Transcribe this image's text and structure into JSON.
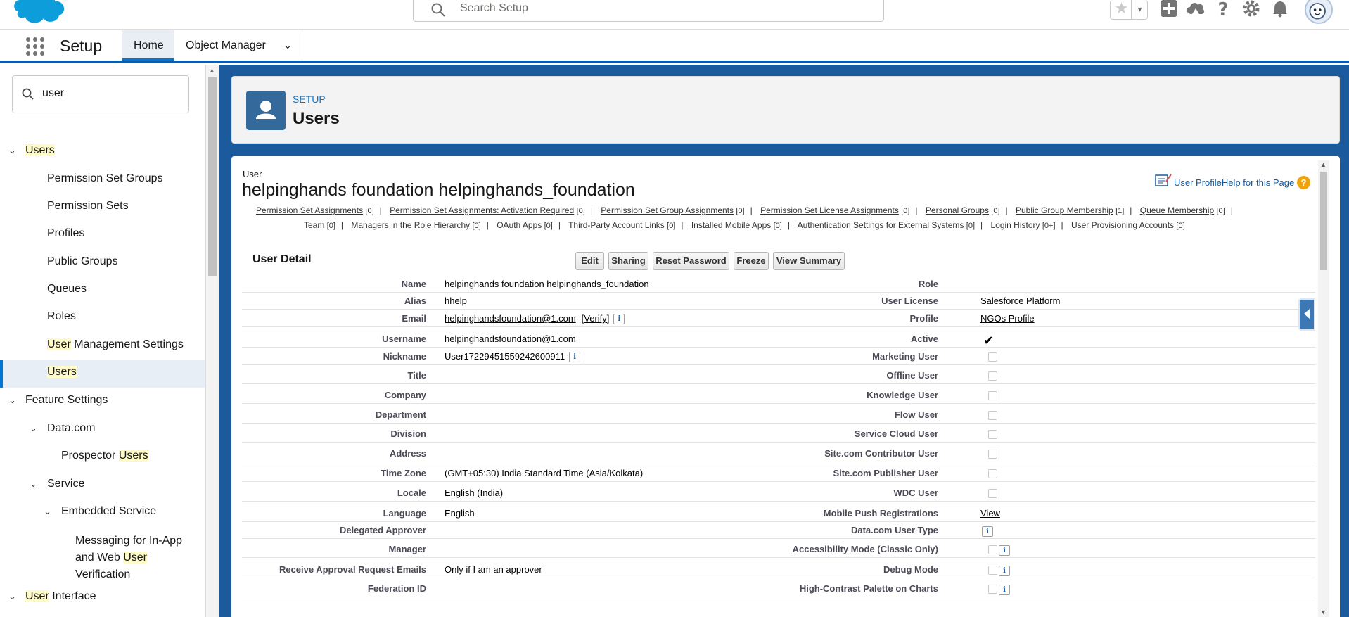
{
  "header": {
    "search_placeholder": "Search Setup",
    "icons": [
      "salesforce-cloud-logo",
      "star-icon",
      "chevron-down-icon",
      "plus-icon",
      "trailhead-icon",
      "help-icon",
      "gear-icon",
      "bell-icon",
      "avatar"
    ]
  },
  "nav": {
    "app_name": "Setup",
    "tabs": [
      {
        "label": "Home"
      },
      {
        "label": "Object Manager"
      }
    ]
  },
  "sidebar": {
    "quickfind_value": "user",
    "items": [
      {
        "label_hl": "Users",
        "label_rest": ""
      },
      {
        "label": "Permission Set Groups"
      },
      {
        "label": "Permission Sets"
      },
      {
        "label": "Profiles"
      },
      {
        "label": "Public Groups"
      },
      {
        "label": "Queues"
      },
      {
        "label": "Roles"
      },
      {
        "label_hl": "User",
        "label_rest": " Management Settings"
      },
      {
        "label_hl": "Users",
        "label_rest": ""
      },
      {
        "label": "Feature Settings"
      },
      {
        "label": "Data.com"
      },
      {
        "label_pre": "Prospector ",
        "label_hl": "Users"
      },
      {
        "label": "Service"
      },
      {
        "label": "Embedded Service"
      },
      {
        "label_line1": "Messaging for In-App",
        "label_line2_pre": "and Web ",
        "label_line2_hl": "User",
        "label_line3": "Verification"
      },
      {
        "label_hl": "User",
        "label_rest": " Interface"
      }
    ]
  },
  "page_header": {
    "eyebrow": "SETUP",
    "title": "Users"
  },
  "user": {
    "type_label": "User",
    "full_name": "helpinghands foundation helpinghands_foundation",
    "help_link": "User ProfileHelp for this Page",
    "help_badge": "?"
  },
  "related_lists": {
    "line1": [
      {
        "label": "Permission Set Assignments",
        "count": "[0]"
      },
      {
        "label": "Permission Set Assignments: Activation Required",
        "count": "[0]"
      },
      {
        "label": "Permission Set Group Assignments",
        "count": "[0]"
      },
      {
        "label": "Permission Set License Assignments",
        "count": "[0]"
      },
      {
        "label": "Personal Groups",
        "count": "[0]"
      },
      {
        "label": "Public Group Membership",
        "count": "[1]"
      },
      {
        "label": "Queue Membership",
        "count": "[0]"
      }
    ],
    "line2": [
      {
        "label": "Team",
        "count": "[0]"
      },
      {
        "label": "Managers in the Role Hierarchy",
        "count": "[0]"
      },
      {
        "label": "OAuth Apps",
        "count": "[0]"
      },
      {
        "label": "Third-Party Account Links",
        "count": "[0]"
      },
      {
        "label": "Installed Mobile Apps",
        "count": "[0]"
      },
      {
        "label": "Authentication Settings for External Systems",
        "count": "[0]"
      },
      {
        "label": "Login History",
        "count": "[0+]"
      },
      {
        "label": "User Provisioning Accounts",
        "count": "[0]"
      }
    ],
    "separator": "|"
  },
  "detail": {
    "section_title": "User Detail",
    "buttons": [
      "Edit",
      "Sharing",
      "Reset Password",
      "Freeze",
      "View Summary"
    ],
    "info_glyph": "i",
    "verify_link": "[Verify]",
    "active_check": "✔",
    "rows": [
      {
        "left_label": "Name",
        "left_value": "helpinghands foundation helpinghands_foundation",
        "right_label": "Role",
        "right_value": ""
      },
      {
        "left_label": "Alias",
        "left_value": "hhelp",
        "right_label": "User License",
        "right_value": "Salesforce Platform"
      },
      {
        "left_label": "Email",
        "left_value": "helpinghandsfoundation@1.com",
        "right_label": "Profile",
        "right_value": "NGOs Profile"
      },
      {
        "left_label": "Username",
        "left_value": "helpinghandsfoundation@1.com",
        "right_label": "Active",
        "right_value": ""
      },
      {
        "left_label": "Nickname",
        "left_value": "User17229451559242600911",
        "right_label": "Marketing User",
        "right_value": ""
      },
      {
        "left_label": "Title",
        "left_value": "",
        "right_label": "Offline User",
        "right_value": ""
      },
      {
        "left_label": "Company",
        "left_value": "",
        "right_label": "Knowledge User",
        "right_value": ""
      },
      {
        "left_label": "Department",
        "left_value": "",
        "right_label": "Flow User",
        "right_value": ""
      },
      {
        "left_label": "Division",
        "left_value": "",
        "right_label": "Service Cloud User",
        "right_value": ""
      },
      {
        "left_label": "Address",
        "left_value": "",
        "right_label": "Site.com Contributor User",
        "right_value": ""
      },
      {
        "left_label": "Time Zone",
        "left_value": "(GMT+05:30) India Standard Time (Asia/Kolkata)",
        "right_label": "Site.com Publisher User",
        "right_value": ""
      },
      {
        "left_label": "Locale",
        "left_value": "English (India)",
        "right_label": "WDC User",
        "right_value": ""
      },
      {
        "left_label": "Language",
        "left_value": "English",
        "right_label": "Mobile Push Registrations",
        "right_value": "View"
      },
      {
        "left_label": "Delegated Approver",
        "left_value": "",
        "right_label": "Data.com User Type",
        "right_value": ""
      },
      {
        "left_label": "Manager",
        "left_value": "",
        "right_label": "Accessibility Mode (Classic Only)",
        "right_value": ""
      },
      {
        "left_label": "Receive Approval Request Emails",
        "left_value": "Only if I am an approver",
        "right_label": "Debug Mode",
        "right_value": ""
      },
      {
        "left_label": "Federation ID",
        "left_value": "",
        "right_label": "High-Contrast Palette on Charts",
        "right_value": ""
      }
    ]
  }
}
